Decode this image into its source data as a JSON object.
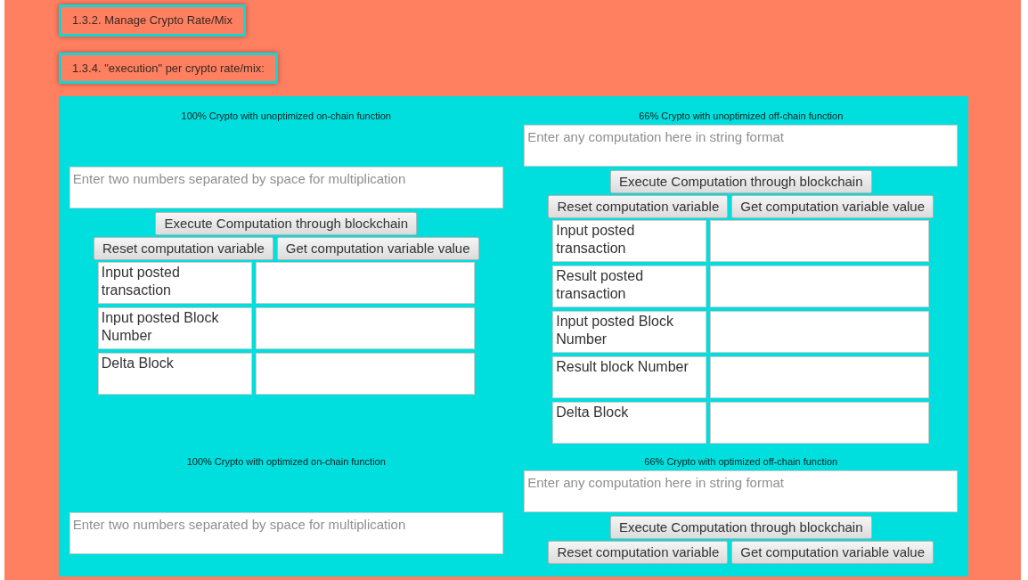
{
  "headings": [
    "1.3.2. Manage Crypto Rate/Mix",
    "1.3.4. \"execution\" per crypto rate/mix:"
  ],
  "sections": [
    {
      "kind": "on-chain",
      "title": "100% Crypto with unoptimized on-chain function",
      "placeholder": "Enter two numbers separated by space for multiplication",
      "execute": "Execute Computation through blockchain",
      "buttons": [
        "Reset computation variable",
        "Get computation variable value"
      ],
      "fields": [
        "Input posted transaction",
        "Input posted Block Number",
        "Delta Block"
      ]
    },
    {
      "kind": "off-chain",
      "title": "66% Crypto with unoptimized off-chain function",
      "placeholder": "Enter any computation here in string format",
      "execute": "Execute Computation through blockchain",
      "buttons": [
        "Reset computation variable",
        "Get computation variable value"
      ],
      "fields": [
        "Input posted transaction",
        "Result posted transaction",
        "Input posted Block Number",
        "Result block Number",
        "Delta Block"
      ]
    },
    {
      "kind": "on-chain",
      "title": "100% Crypto with optimized on-chain function",
      "placeholder": "Enter two numbers separated by space for multiplication"
    },
    {
      "kind": "off-chain",
      "title": "66% Crypto with optimized off-chain function",
      "placeholder": "Enter any computation here in string format",
      "execute": "Execute Computation through blockchain",
      "buttons": [
        "Reset computation variable",
        "Get computation variable value"
      ]
    }
  ]
}
